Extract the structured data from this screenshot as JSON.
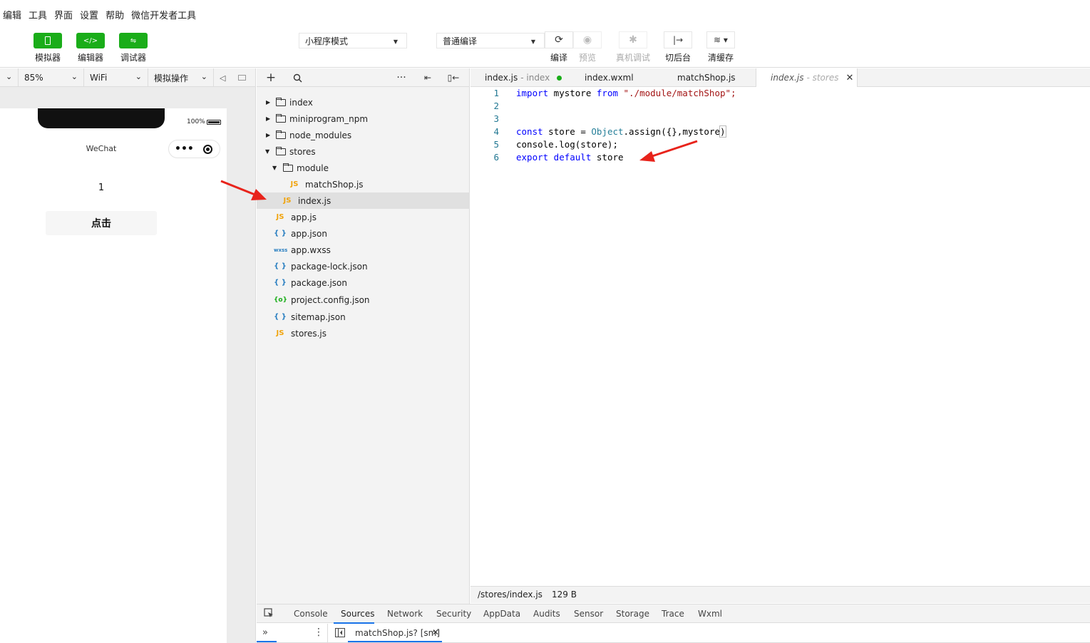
{
  "menu": [
    "编辑",
    "工具",
    "界面",
    "设置",
    "帮助",
    "微信开发者工具"
  ],
  "toolbar": {
    "simulator_label": "模拟器",
    "editor_label": "编辑器",
    "debugger_label": "调试器",
    "mode_select": "小程序模式",
    "compile_select": "普通编译",
    "compile_label": "编译",
    "preview_label": "预览",
    "remote_debug_label": "真机调试",
    "background_label": "切后台",
    "clear_cache_label": "清缓存"
  },
  "simbar": {
    "zoom": "85%",
    "network": "WiFi",
    "sim_ops": "模拟操作"
  },
  "simulator": {
    "battery": "100%",
    "nav_title": "WeChat",
    "count": "1",
    "button_label": "点击"
  },
  "explorer": {
    "items": [
      {
        "name": "index",
        "type": "folder"
      },
      {
        "name": "miniprogram_npm",
        "type": "folder"
      },
      {
        "name": "node_modules",
        "type": "folder"
      },
      {
        "name": "stores",
        "type": "folder"
      },
      {
        "name": "module",
        "type": "folder"
      },
      {
        "name": "matchShop.js",
        "type": "js"
      },
      {
        "name": "index.js",
        "type": "js"
      },
      {
        "name": "app.js",
        "type": "js"
      },
      {
        "name": "app.json",
        "type": "json"
      },
      {
        "name": "app.wxss",
        "type": "wxss"
      },
      {
        "name": "package-lock.json",
        "type": "json"
      },
      {
        "name": "package.json",
        "type": "json"
      },
      {
        "name": "project.config.json",
        "type": "config"
      },
      {
        "name": "sitemap.json",
        "type": "json"
      },
      {
        "name": "stores.js",
        "type": "js"
      }
    ],
    "icon_js": "JS",
    "icon_json": "{ }",
    "icon_wxss": "wxss",
    "icon_config": "{o}"
  },
  "tabs": [
    {
      "name": "index.js",
      "sub": "- index"
    },
    {
      "name": "index.wxml",
      "sub": ""
    },
    {
      "name": "matchShop.js",
      "sub": ""
    },
    {
      "name": "index.js",
      "sub": "- stores"
    }
  ],
  "code": {
    "line_numbers": [
      "1",
      "2",
      "3",
      "4",
      "5",
      "6"
    ],
    "l1": {
      "import": "import",
      "name": " mystore ",
      "from": "from",
      "path": " \"./module/matchShop\";"
    },
    "l4": {
      "const": "const",
      "store": " store = ",
      "object": "Object",
      "assign": ".assign(",
      "args": "{},mystore",
      "close": ")"
    },
    "l5": "console.log(store);",
    "l6": {
      "export": "export",
      "default": " default",
      "store": " store"
    }
  },
  "status": {
    "path": "/stores/index.js",
    "size": "129 B"
  },
  "devtools": {
    "tabs": [
      "Console",
      "Sources",
      "Network",
      "Security",
      "AppData",
      "Audits",
      "Sensor",
      "Storage",
      "Trace",
      "Wxml"
    ],
    "source_file": "matchShop.js? [sm]"
  },
  "colors": {
    "accent": "#1aad19",
    "arrow": "#e8231b"
  }
}
